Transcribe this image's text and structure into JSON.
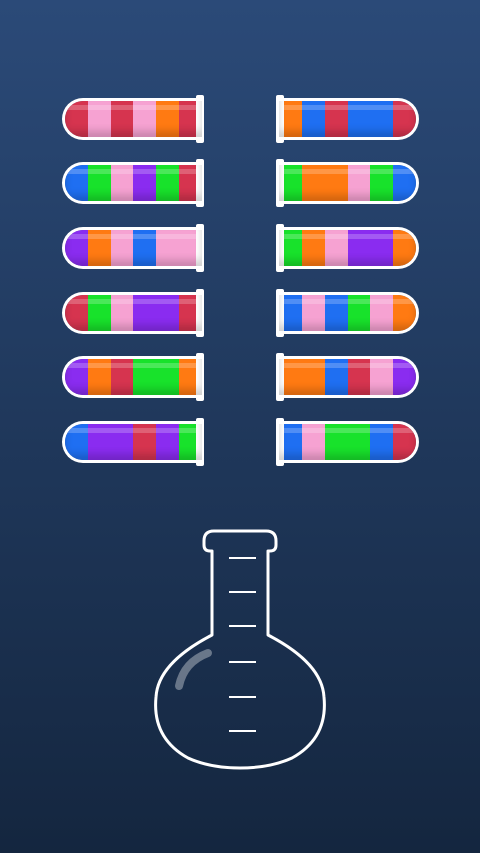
{
  "game": {
    "name": "ball-sort-tubes",
    "colors": {
      "red": "#d6344f",
      "pink": "#f6a2d2",
      "orange": "#ff7a12",
      "blue": "#1f6ff2",
      "green": "#18e22b",
      "purple": "#8a2cf0"
    },
    "background": {
      "top": "#2b4a78",
      "bottom": "#14263f"
    },
    "tubes_left": [
      [
        "red",
        "pink",
        "red",
        "pink",
        "orange",
        "red"
      ],
      [
        "blue",
        "green",
        "pink",
        "purple",
        "green",
        "red"
      ],
      [
        "purple",
        "orange",
        "pink",
        "blue",
        "pink",
        "pink"
      ],
      [
        "red",
        "green",
        "pink",
        "purple",
        "purple",
        "red"
      ],
      [
        "purple",
        "orange",
        "red",
        "green",
        "green",
        "orange"
      ],
      [
        "blue",
        "purple",
        "purple",
        "red",
        "purple",
        "green"
      ]
    ],
    "tubes_right": [
      [
        "red",
        "blue",
        "blue",
        "red",
        "blue",
        "orange"
      ],
      [
        "blue",
        "green",
        "pink",
        "orange",
        "orange",
        "green"
      ],
      [
        "orange",
        "purple",
        "purple",
        "pink",
        "orange",
        "green"
      ],
      [
        "orange",
        "pink",
        "green",
        "blue",
        "pink",
        "blue"
      ],
      [
        "purple",
        "pink",
        "red",
        "blue",
        "orange",
        "orange"
      ],
      [
        "red",
        "blue",
        "green",
        "green",
        "pink",
        "blue"
      ]
    ],
    "flask": {
      "state": "empty",
      "graduation_marks": 6,
      "icon": "erlenmeyer-flask-icon"
    }
  }
}
